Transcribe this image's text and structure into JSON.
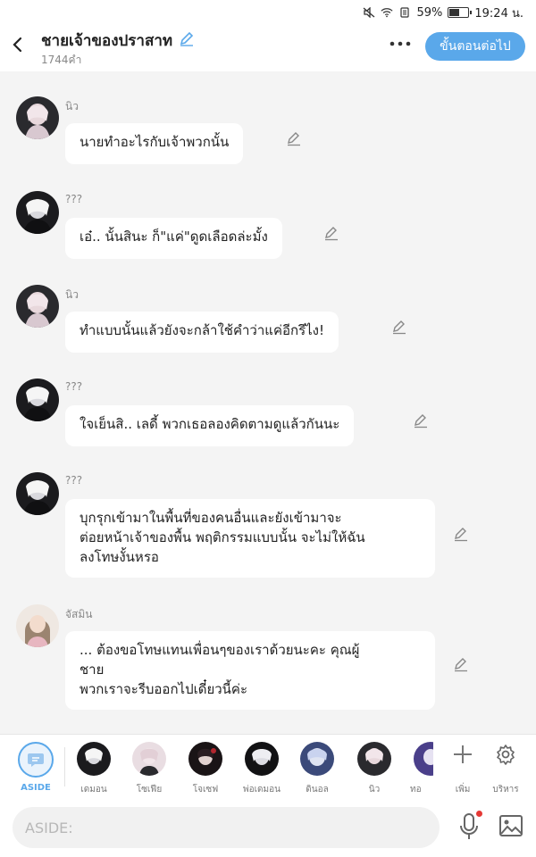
{
  "status": {
    "battery": "59%",
    "time": "19:24 น.",
    "battery_level": 0.59
  },
  "header": {
    "title": "ชายเจ้าของปราสาท",
    "word_count": "1744คำ",
    "next_button": "ขั้นตอนต่อไป"
  },
  "messages": [
    {
      "sender": "นิว",
      "text": "นายทำอะไรกับเจ้าพวกนั้น"
    },
    {
      "sender": "???",
      "text": "เอ๋.. นั้นสินะ ก็\"แค่\"ดูดเลือดล่ะมั้ง"
    },
    {
      "sender": "นิว",
      "text": "ทำแบบนั้นแล้วยังจะกล้าใช้คำว่าแค่อีกรึไง!"
    },
    {
      "sender": "???",
      "text": "ใจเย็นสิ.. เลดี้ พวกเธอลองคิดตามดูแล้วกันนะ"
    },
    {
      "sender": "???",
      "lines": [
        "บุกรุกเข้ามาในพื้นที่ของคนอื่นและยังเข้ามาจะ",
        "ต่อยหน้าเจ้าของพื้น พฤติกรรมแบบนั้น จะไม่ให้ฉัน",
        "ลงโทษงั้นหรอ"
      ]
    },
    {
      "sender": "จัสมิน",
      "lines": [
        "... ต้องขอโทษแทนเพื่อนๆของเราด้วยนะคะ คุณผู้",
        "ชาย",
        "พวกเราจะรีบออกไปเดี๋ยวนี้ค่ะ"
      ]
    }
  ],
  "charbar": {
    "aside_label": "ASIDE",
    "characters": [
      "เดมอน",
      "โซเฟีย",
      "โจเซฟ",
      "พ่อเดมอน",
      "ดินอล",
      "นิว",
      "ทอ"
    ],
    "add_label": "เพิ่ม",
    "manage_label": "บริหาร"
  },
  "input": {
    "placeholder": "ASIDE:"
  }
}
